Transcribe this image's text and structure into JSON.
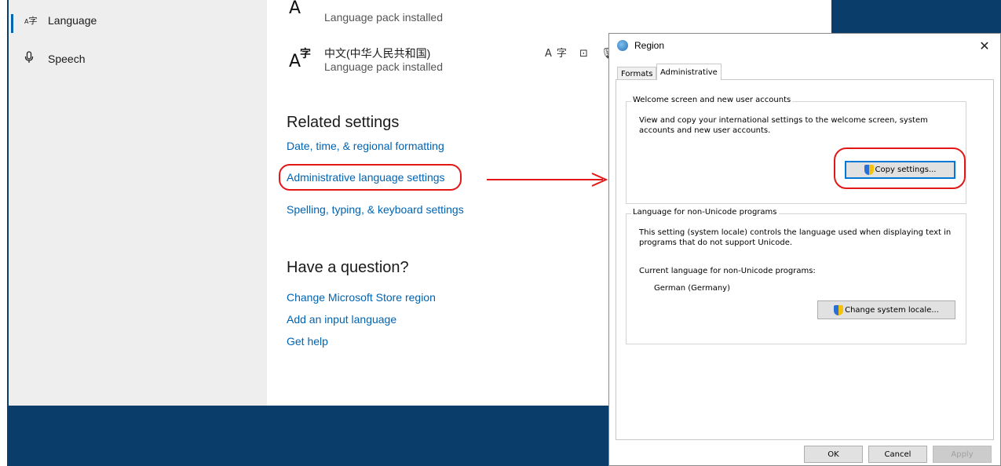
{
  "sidebar": {
    "items": [
      {
        "icon": "A字",
        "label": "Language",
        "selected": true
      },
      {
        "icon": "🎙",
        "label": "Speech",
        "selected": false
      }
    ]
  },
  "languages": [
    {
      "glyph": "A",
      "name": "",
      "status": "Language pack installed"
    },
    {
      "glyph": "A字",
      "name": "中文(中华人民共和国)",
      "status": "Language pack installed"
    }
  ],
  "feature_icons": "A字 ⊡ 🎙",
  "related": {
    "heading": "Related settings",
    "links": [
      "Date, time, & regional formatting",
      "Administrative language settings",
      "Spelling, typing, & keyboard settings"
    ]
  },
  "question": {
    "heading": "Have a question?",
    "links": [
      "Change Microsoft Store region",
      "Add an input language",
      "Get help"
    ]
  },
  "dialog": {
    "title": "Region",
    "close": "✕",
    "tabs": [
      "Formats",
      "Administrative"
    ],
    "active_tab": "Administrative",
    "welcome": {
      "title": "Welcome screen and new user accounts",
      "text": "View and copy your international settings to the welcome screen, system accounts and new user accounts.",
      "button": "Copy settings..."
    },
    "nonunicode": {
      "title": "Language for non-Unicode programs",
      "text": "This setting (system locale) controls the language used when displaying text in programs that do not support Unicode.",
      "current_label": "Current language for non-Unicode programs:",
      "current_value": "German (Germany)",
      "button": "Change system locale..."
    },
    "buttons": {
      "ok": "OK",
      "cancel": "Cancel",
      "apply": "Apply"
    }
  },
  "colors": {
    "accent": "#0063b1",
    "annotation": "#e21818",
    "desktop": "#0b3d6b"
  }
}
